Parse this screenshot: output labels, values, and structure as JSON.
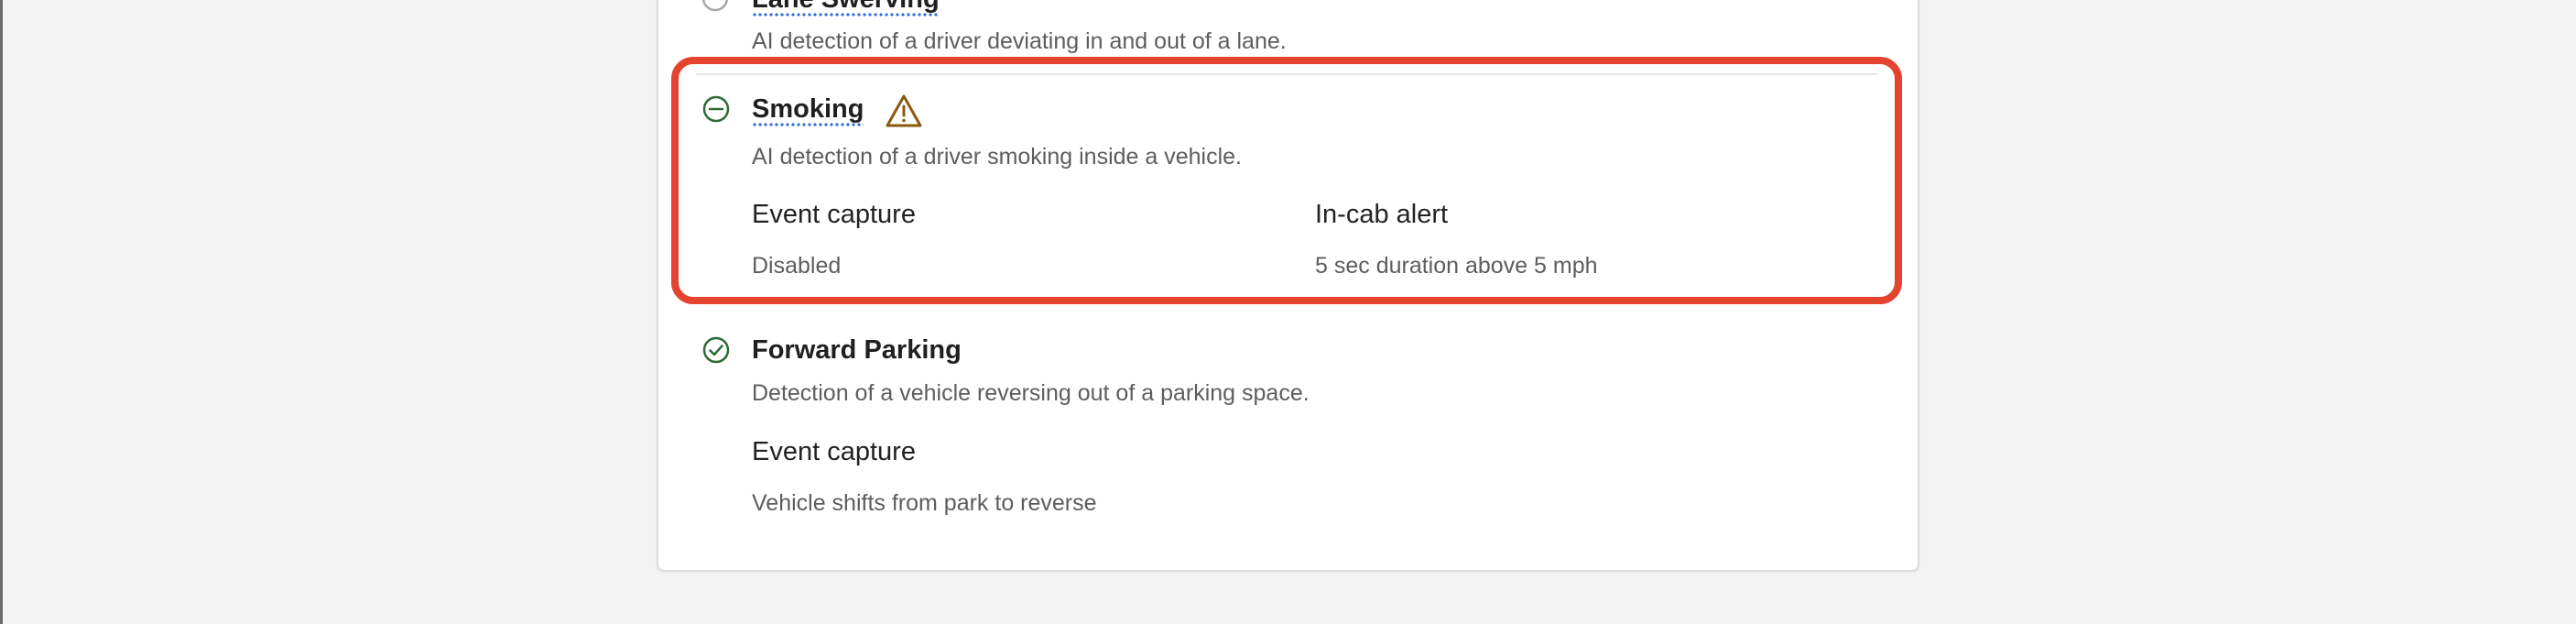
{
  "rules": [
    {
      "title": "Lane Swerving",
      "description": "AI detection of a driver deviating in and out of a lane."
    },
    {
      "title": "Smoking",
      "status_icon": "minus-circle-icon",
      "warning_icon": "warning-triangle-icon",
      "description": "AI detection of a driver smoking inside a vehicle.",
      "settings": [
        {
          "label": "Event capture",
          "value": "Disabled"
        },
        {
          "label": "In-cab alert",
          "value": "5 sec duration above 5 mph"
        }
      ]
    },
    {
      "title": "Forward Parking",
      "status_icon": "check-circle-icon",
      "description": "Detection of a vehicle reversing out of a parking space.",
      "settings": [
        {
          "label": "Event capture",
          "value": "Vehicle shifts from park to reverse"
        }
      ]
    }
  ],
  "colors": {
    "highlight": "#e4432d",
    "status_green": "#2f6b3a",
    "warning": "#8a5a12",
    "link_dots": "#2a6fd6"
  }
}
